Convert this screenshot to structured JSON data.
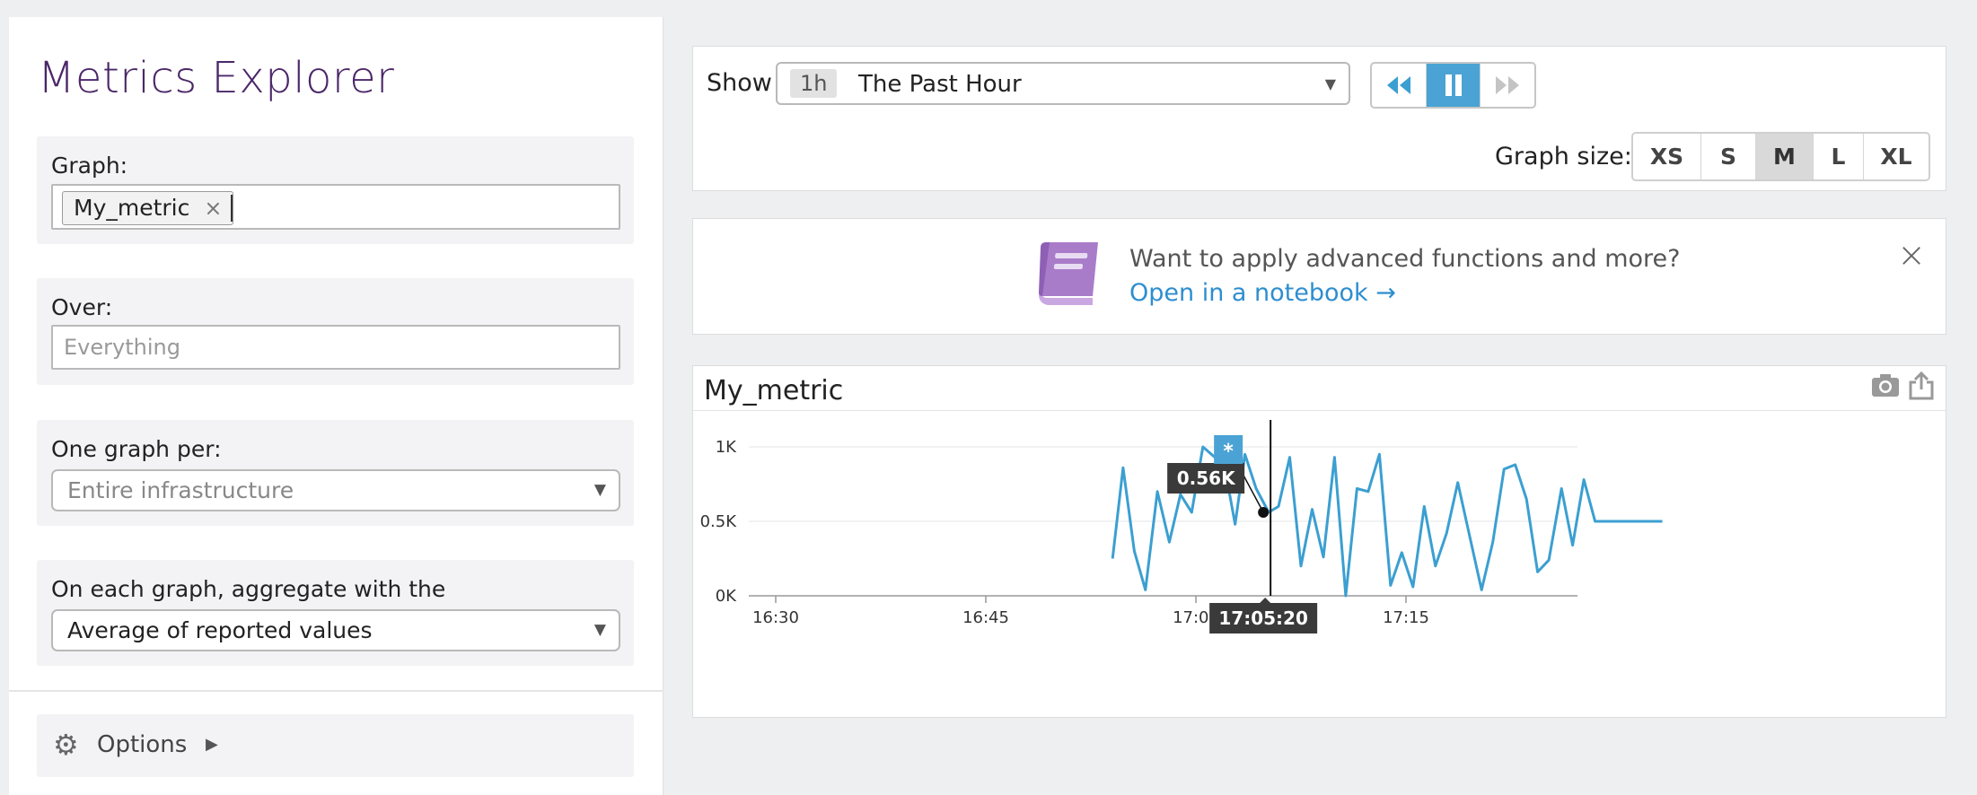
{
  "sidebar": {
    "title": "Metrics Explorer",
    "graph": {
      "label": "Graph:",
      "tag": "My_metric",
      "tag_close": "×"
    },
    "over": {
      "label": "Over:",
      "placeholder": "Everything"
    },
    "one_graph_per": {
      "label": "One graph per:",
      "value": "Entire infrastructure"
    },
    "aggregate": {
      "label": "On each graph, aggregate with the",
      "value": "Average of reported values"
    },
    "options": {
      "label": "Options"
    }
  },
  "controls": {
    "show_label": "Show",
    "time_badge": "1h",
    "time_value": "The Past Hour",
    "graph_size_label": "Graph size:",
    "sizes": [
      "XS",
      "S",
      "M",
      "L",
      "XL"
    ],
    "selected_size": "M",
    "playback_state": "paused"
  },
  "banner": {
    "text": "Want to apply advanced functions and more?",
    "link": "Open in a notebook →",
    "close": "×"
  },
  "graph": {
    "title": "My_metric",
    "hover_value": "0.56K",
    "hover_time": "17:05:20",
    "event_marker": "*"
  },
  "colors": {
    "accent": "#4aa3d4",
    "line": "#3b9fd1",
    "title": "#4b2768",
    "link": "#2e8ecf"
  },
  "chart_data": {
    "type": "line",
    "title": "My_metric",
    "xlabel": "",
    "ylabel": "",
    "x_ticks": [
      "16:30",
      "16:45",
      "17:00",
      "17:15"
    ],
    "y_ticks": [
      "0K",
      "0.5K",
      "1K"
    ],
    "ylim": [
      0,
      1000
    ],
    "xlim_minutes": [
      16.0,
      75.5
    ],
    "series": [
      {
        "x": [
          54.05,
          54.8,
          55.6,
          56.4,
          57.25,
          58.1,
          58.9,
          59.7,
          60.5,
          61.35,
          62.2,
          62.8,
          63.5,
          64.3,
          65.2,
          65.9,
          66.7,
          67.5,
          68.3,
          69.1,
          69.9,
          70.7,
          71.5,
          72.3,
          73.1,
          73.9,
          74.7,
          75.5,
          76.3,
          77.1,
          77.9,
          78.7,
          79.5,
          80.4,
          81.2,
          82.0,
          82.8,
          83.6,
          84.4,
          85.2,
          86.1,
          86.9,
          87.7,
          88.5,
          89.3,
          90.1,
          90.9,
          91.8,
          92.6,
          93.3
        ],
        "values": [
          250,
          860,
          300,
          40,
          700,
          360,
          680,
          560,
          1000,
          930,
          790,
          480,
          950,
          720,
          560,
          600,
          930,
          200,
          580,
          260,
          930,
          0,
          720,
          700,
          950,
          70,
          290,
          60,
          600,
          200,
          420,
          760,
          420,
          40,
          360,
          850,
          880,
          650,
          160,
          240,
          720,
          340,
          780,
          500,
          500,
          500,
          500,
          500,
          500,
          500
        ]
      }
    ],
    "hover": {
      "x": "17:05:20",
      "y": 560,
      "label": "0.56K"
    }
  }
}
